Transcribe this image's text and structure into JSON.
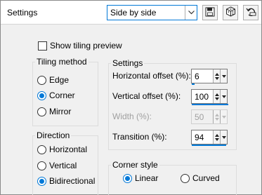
{
  "header": {
    "title": "Settings",
    "preset_value": "Side by side"
  },
  "toolbar": {
    "save_icon": "save-icon",
    "randomize_icon": "dice-icon",
    "reset_icon": "reset-icon"
  },
  "show_preview": {
    "label": "Show tiling preview",
    "checked": false
  },
  "tiling_method": {
    "title": "Tiling method",
    "options": [
      "Edge",
      "Corner",
      "Mirror"
    ],
    "selected": "Corner"
  },
  "direction": {
    "title": "Direction",
    "options": [
      "Horizontal",
      "Vertical",
      "Bidirectional"
    ],
    "selected": "Bidirectional"
  },
  "settings": {
    "title": "Settings",
    "horizontal_offset": {
      "label": "Horizontal offset (%):",
      "value": "6"
    },
    "vertical_offset": {
      "label": "Vertical offset (%):",
      "value": "100"
    },
    "width": {
      "label": "Width (%):",
      "value": "50",
      "enabled": false
    },
    "transition": {
      "label": "Transition (%):",
      "value": "94"
    }
  },
  "corner_style": {
    "title": "Corner style",
    "options": [
      "Linear",
      "Curved"
    ],
    "selected": "Linear"
  },
  "colors": {
    "accent": "#0078d7"
  }
}
